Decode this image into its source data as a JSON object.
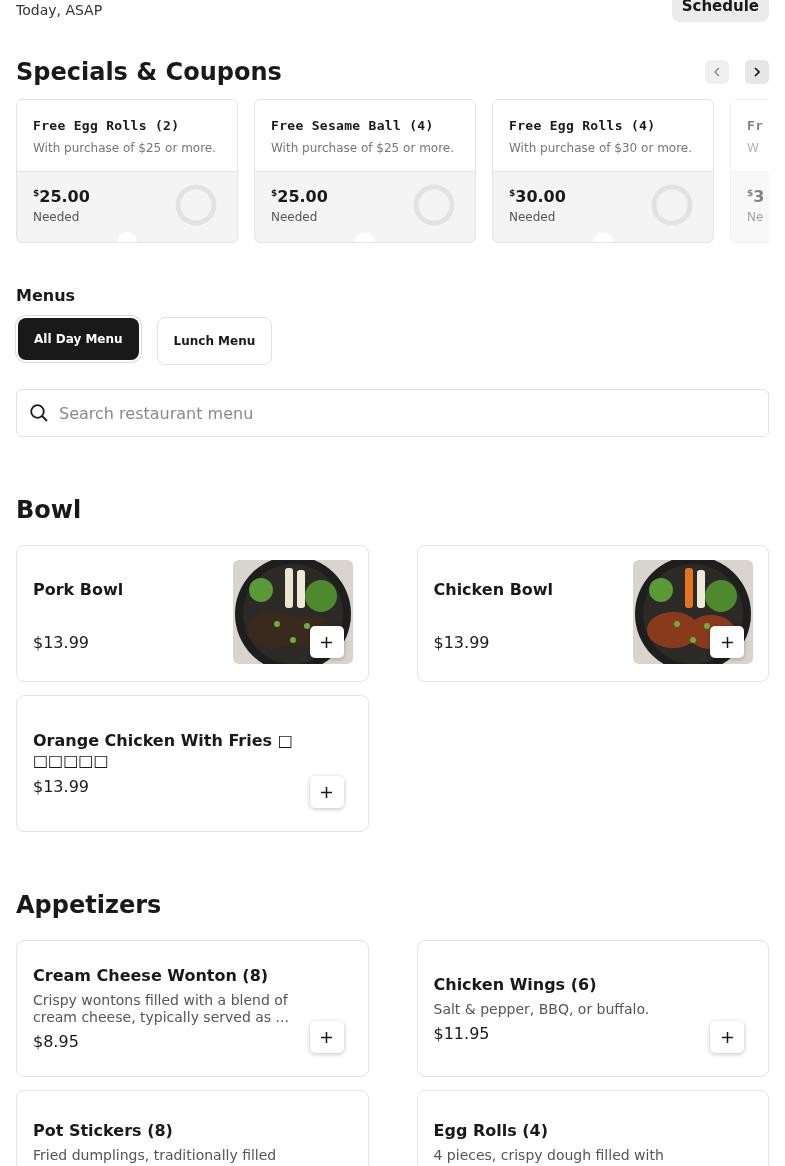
{
  "order_time": {
    "text": "Today, ASAP",
    "button": "Schedule"
  },
  "specials": {
    "title": "Specials & Coupons",
    "coupons": [
      {
        "title": "Free Egg Rolls (2)",
        "description": "With purchase of $25 or more.",
        "currency": "$",
        "amount": "25.00",
        "label": "Needed"
      },
      {
        "title": "Free Sesame Ball (4)",
        "description": "With purchase of $25 or more.",
        "currency": "$",
        "amount": "25.00",
        "label": "Needed"
      },
      {
        "title": "Free Egg Rolls (4)",
        "description": "With purchase of $30 or more.",
        "currency": "$",
        "amount": "30.00",
        "label": "Needed"
      },
      {
        "title": "Fr",
        "description": "W",
        "currency": "$",
        "amount": "3",
        "label": "Ne"
      }
    ]
  },
  "menus": {
    "title": "Menus",
    "tabs": [
      {
        "label": "All Day Menu",
        "selected": true
      },
      {
        "label": "Lunch Menu",
        "selected": false
      }
    ]
  },
  "search": {
    "placeholder": "Search restaurant menu"
  },
  "sections": [
    {
      "title": "Bowl",
      "items": [
        {
          "name": "Pork Bowl",
          "price": "$13.99"
        },
        {
          "name": "Chicken Bowl",
          "price": "$13.99"
        },
        {
          "name": "Orange Chicken With Fries □\n□□□□□",
          "price": "$13.99"
        }
      ]
    },
    {
      "title": "Appetizers",
      "items": [
        {
          "name": "Cream Cheese Wonton (8)",
          "description": "Crispy wontons filled with a blend of cream cheese, typically served as ...",
          "price": "$8.95"
        },
        {
          "name": "Chicken Wings (6)",
          "description": "Salt & pepper, BBQ, or buffalo.",
          "price": "$11.95"
        },
        {
          "name": "Pot Stickers (8)",
          "description": "Fried dumplings, traditionally filled"
        },
        {
          "name": "Egg Rolls (4)",
          "description": "4 pieces, crispy dough filled with"
        }
      ]
    }
  ]
}
